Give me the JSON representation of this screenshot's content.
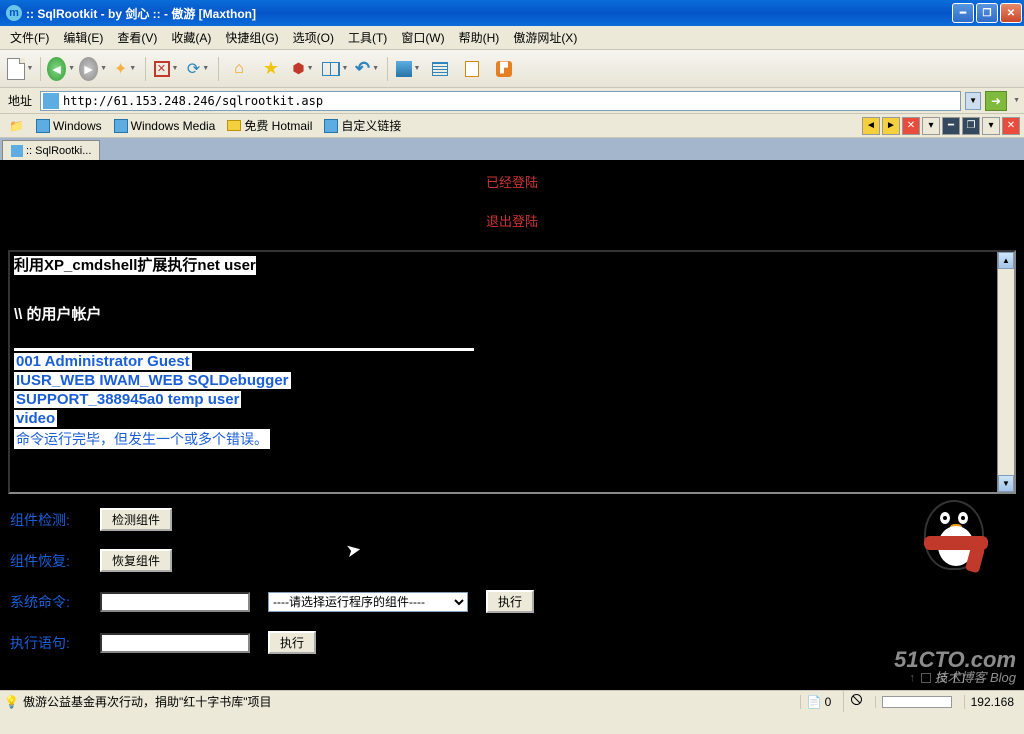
{
  "titlebar": {
    "text": ":: SqlRootkit - by 剑心 :: - 傲游 [Maxthon]"
  },
  "menus": {
    "file": "文件(F)",
    "edit": "编辑(E)",
    "view": "查看(V)",
    "favorites": "收藏(A)",
    "groups": "快捷组(G)",
    "options": "选项(O)",
    "tools": "工具(T)",
    "window": "窗口(W)",
    "help": "帮助(H)",
    "maxthon": "傲游网址(X)"
  },
  "addressbar": {
    "label": "地址",
    "url": "http://61.153.248.246/sqlrootkit.asp"
  },
  "links": {
    "windows": "Windows",
    "windows_media": "Windows Media",
    "hotmail": "免费 Hotmail",
    "custom": "自定义链接"
  },
  "tab": {
    "title": ":: SqlRootki..."
  },
  "page": {
    "logged_in": "已经登陆",
    "logout": "退出登陆",
    "cmd_prefix": "利用",
    "cmd_xp": "XP_cmdshell",
    "cmd_mid": "扩展执行",
    "cmd_net": "net user",
    "accounts_label": "\\\\ 的用户帐户",
    "users_r1": "001            Administrator        Guest",
    "users_r2": "IUSR_WEB          IWAM_WEB           SQLDebugger",
    "users_r3": "SUPPORT_388945a0     temp             user",
    "users_r4": "video",
    "cmd_result": "命令运行完毕，但发生一个或多个错误。",
    "component_check_label": "组件检测:",
    "component_check_btn": "检测组件",
    "component_restore_label": "组件恢复:",
    "component_restore_btn": "恢复组件",
    "system_cmd_label": "系统命令:",
    "select_placeholder": "----请选择运行程序的组件----",
    "execute_btn": "执行",
    "exec_stmt_label": "执行语句:"
  },
  "statusbar": {
    "text": "傲游公益基金再次行动，捐助\"红十字书库\"项目",
    "count": "0",
    "ip": "192.168"
  },
  "watermark": {
    "main": "51CTO.com",
    "sub": "技术博客  Blog"
  }
}
